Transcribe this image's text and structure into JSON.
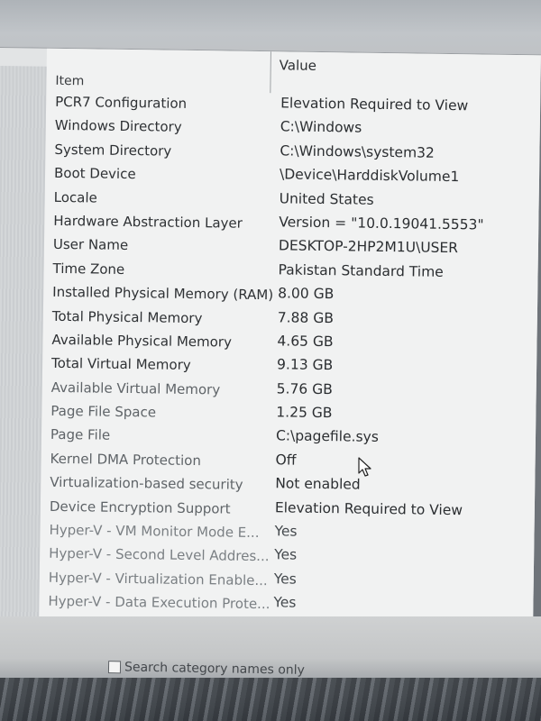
{
  "columns": {
    "item": "Item",
    "value": "Value"
  },
  "rows": [
    {
      "item": "PCR7 Configuration",
      "value": "Elevation Required to View"
    },
    {
      "item": "Windows Directory",
      "value": "C:\\Windows"
    },
    {
      "item": "System Directory",
      "value": "C:\\Windows\\system32"
    },
    {
      "item": "Boot Device",
      "value": "\\Device\\HarddiskVolume1"
    },
    {
      "item": "Locale",
      "value": "United States"
    },
    {
      "item": "Hardware Abstraction Layer",
      "value": "Version = \"10.0.19041.5553\""
    },
    {
      "item": "User Name",
      "value": "DESKTOP-2HP2M1U\\USER"
    },
    {
      "item": "Time Zone",
      "value": "Pakistan Standard Time"
    },
    {
      "item": "Installed Physical Memory (RAM)",
      "value": "8.00 GB"
    },
    {
      "item": "Total Physical Memory",
      "value": "7.88 GB"
    },
    {
      "item": "Available Physical Memory",
      "value": "4.65 GB"
    },
    {
      "item": "Total Virtual Memory",
      "value": "9.13 GB"
    },
    {
      "item": "Available Virtual Memory",
      "value": "5.76 GB"
    },
    {
      "item": "Page File Space",
      "value": "1.25 GB"
    },
    {
      "item": "Page File",
      "value": "C:\\pagefile.sys"
    },
    {
      "item": "Kernel DMA Protection",
      "value": "Off"
    },
    {
      "item": "Virtualization-based security",
      "value": "Not enabled"
    },
    {
      "item": "Device Encryption Support",
      "value": "Elevation Required to View"
    },
    {
      "item": "Hyper-V - VM Monitor Mode E...",
      "value": "Yes"
    },
    {
      "item": "Hyper-V - Second Level Addres...",
      "value": "Yes"
    },
    {
      "item": "Hyper-V - Virtualization Enable...",
      "value": "Yes"
    },
    {
      "item": "Hyper-V - Data Execution Prote...",
      "value": "Yes"
    }
  ],
  "footer": {
    "search_category_label": "Search category names only",
    "search_category_checked": false
  },
  "icons": {
    "cursor": "mouse-pointer-icon"
  }
}
